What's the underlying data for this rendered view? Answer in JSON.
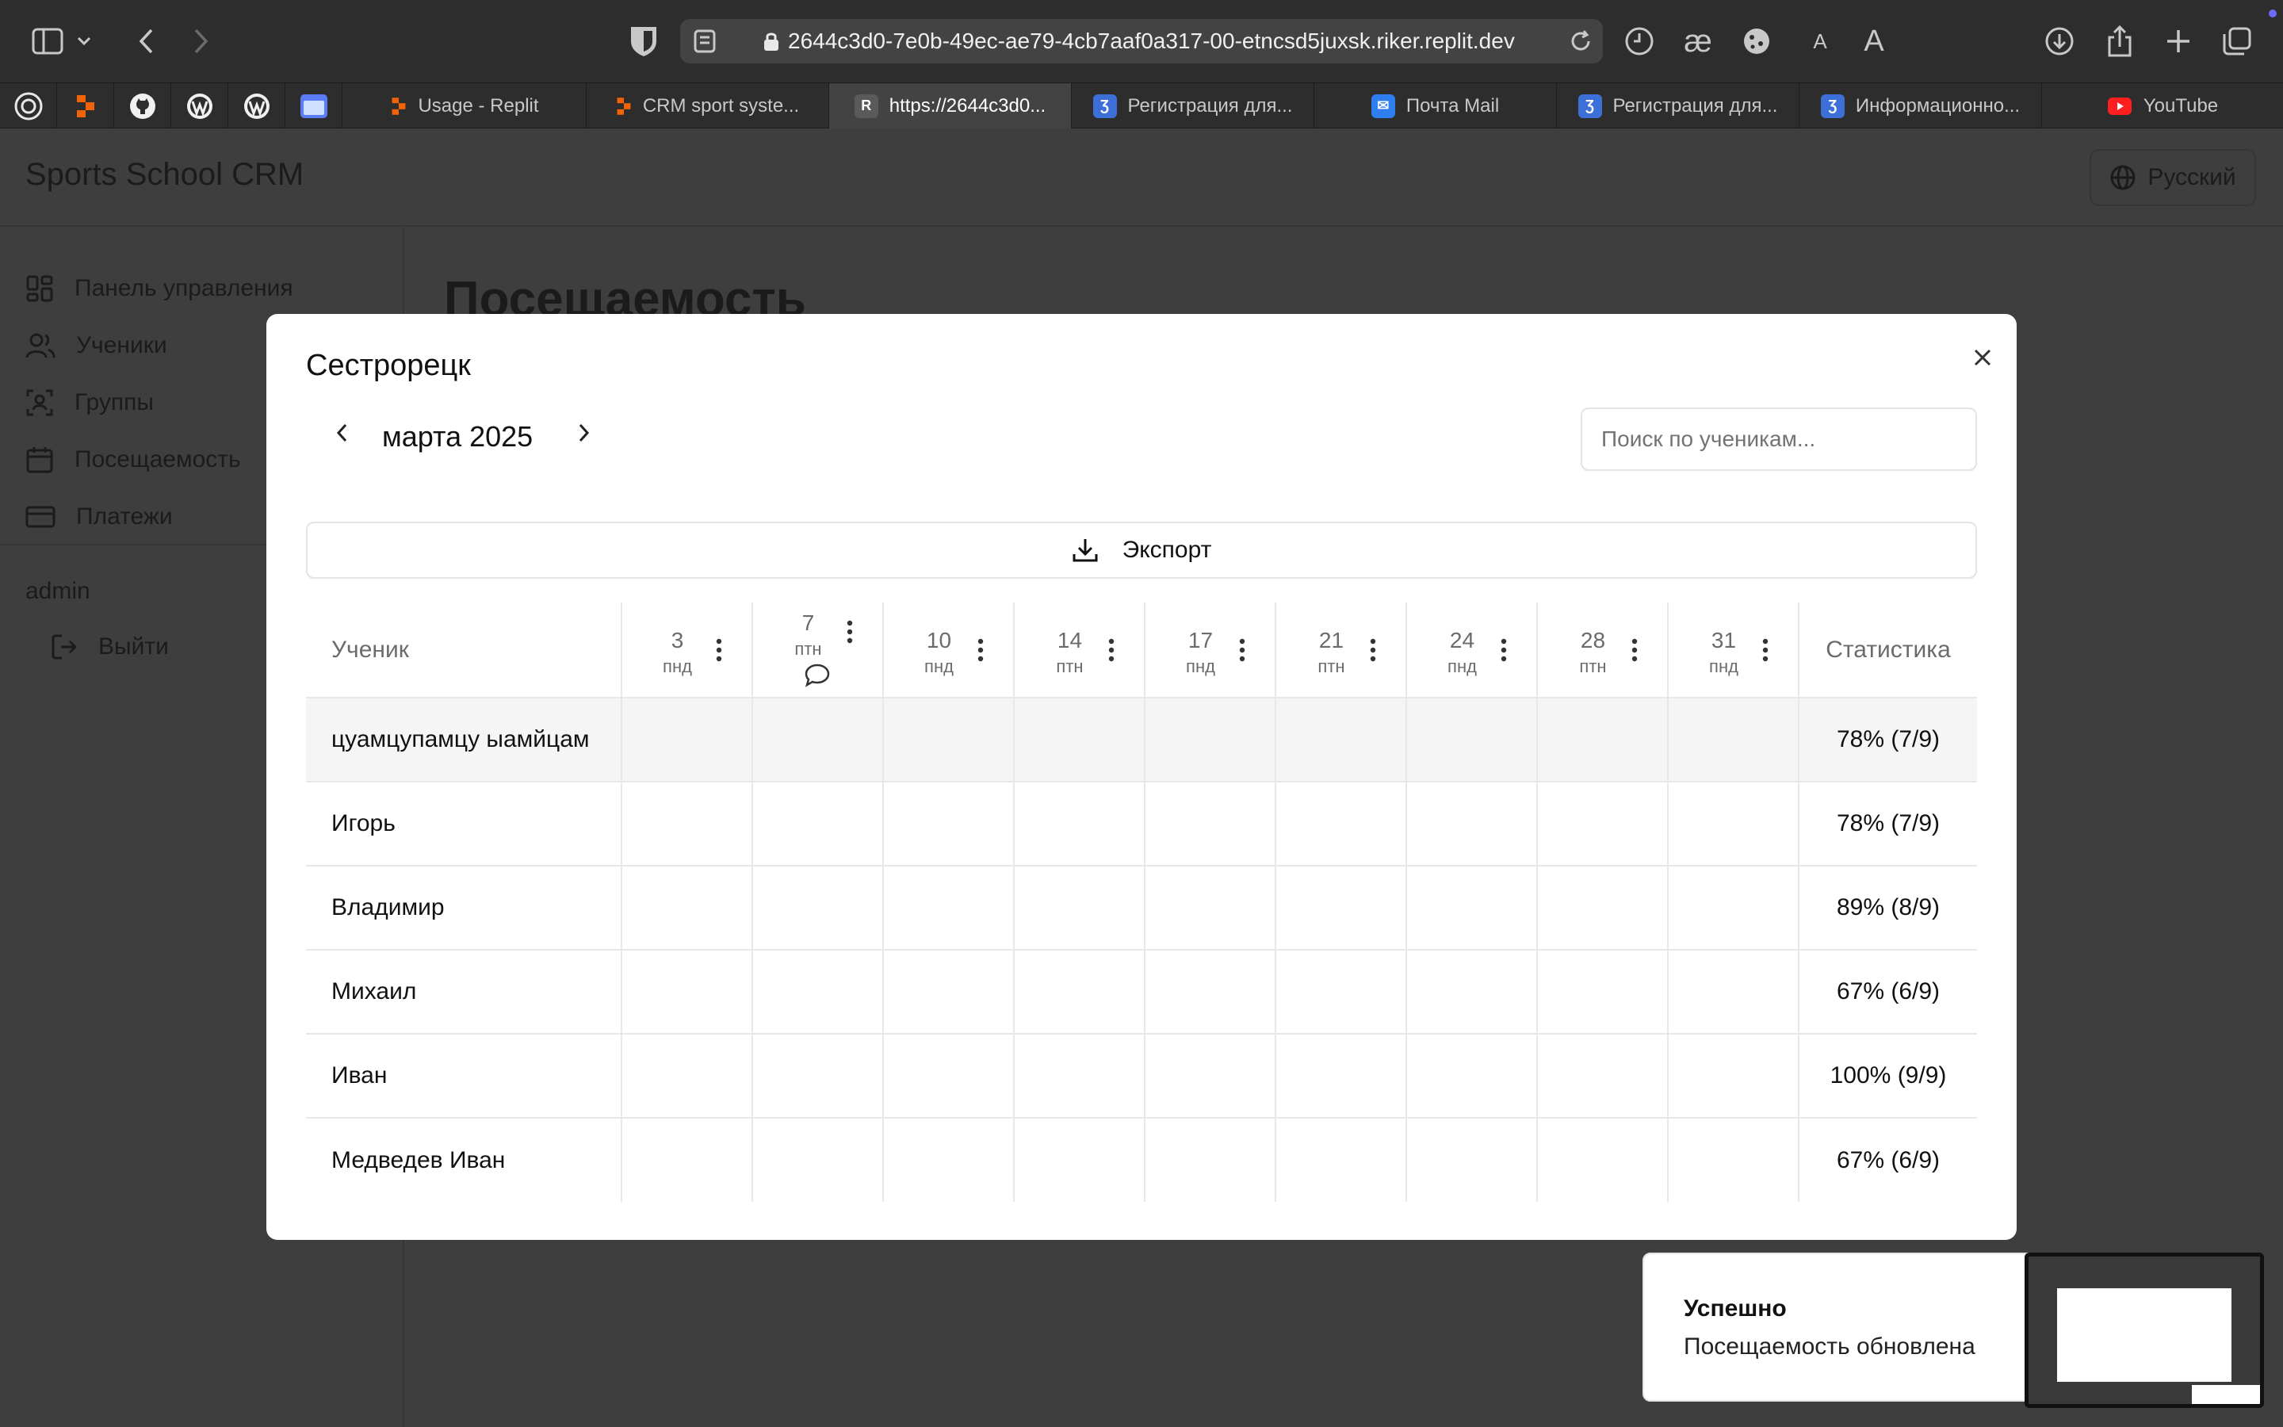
{
  "browser": {
    "url": "2644c3d0-7e0b-49ec-ae79-4cb7aaf0a317-00-etncsd5juxsk.riker.replit.dev",
    "tabs": [
      {
        "label": "Usage - Replit",
        "favicon": "replit-icon",
        "active": false
      },
      {
        "label": "CRM sport syste...",
        "favicon": "replit-icon",
        "active": false
      },
      {
        "label": "https://2644c3d0...",
        "favicon": "r-icon",
        "active": true
      },
      {
        "label": "Регистрация для...",
        "favicon": "gosuslugi-icon",
        "active": false
      },
      {
        "label": "Почта Mail",
        "favicon": "mail-icon",
        "active": false
      },
      {
        "label": "Регистрация для...",
        "favicon": "gosuslugi-icon",
        "active": false
      },
      {
        "label": "Информационно...",
        "favicon": "gosuslugi-icon",
        "active": false
      },
      {
        "label": "YouTube",
        "favicon": "youtube-icon",
        "active": false
      }
    ],
    "pinned": [
      "chatgpt-icon",
      "replit-icon",
      "github-icon",
      "wordpress-icon",
      "wordpress-icon",
      "files-icon"
    ]
  },
  "app": {
    "title": "Sports School CRM",
    "language": "Русский",
    "nav": [
      "Панель управления",
      "Ученики",
      "Группы",
      "Посещаемость",
      "Платежи"
    ],
    "user": "admin",
    "logout": "Выйти",
    "page_heading": "Посещаемость"
  },
  "modal": {
    "title": "Сестрорецк",
    "month": "марта 2025",
    "search_placeholder": "Поиск по ученикам...",
    "export_label": "Экспорт",
    "table": {
      "student_header": "Ученик",
      "stats_header": "Статистика",
      "dates": [
        {
          "num": "3",
          "day": "пнд",
          "note": false
        },
        {
          "num": "7",
          "day": "птн",
          "note": true
        },
        {
          "num": "10",
          "day": "пнд",
          "note": false
        },
        {
          "num": "14",
          "day": "птн",
          "note": false
        },
        {
          "num": "17",
          "day": "пнд",
          "note": false
        },
        {
          "num": "21",
          "day": "птн",
          "note": false
        },
        {
          "num": "24",
          "day": "пнд",
          "note": false
        },
        {
          "num": "28",
          "day": "птн",
          "note": false
        },
        {
          "num": "31",
          "day": "пнд",
          "note": false
        }
      ],
      "rows": [
        {
          "name": "цуамцупамцу ыамйцам",
          "stat": "78% (7/9)"
        },
        {
          "name": "Игорь",
          "stat": "78% (7/9)"
        },
        {
          "name": "Владимир",
          "stat": "89% (8/9)"
        },
        {
          "name": "Михаил",
          "stat": "67% (6/9)"
        },
        {
          "name": "Иван",
          "stat": "100% (9/9)"
        },
        {
          "name": "Медведев Иван",
          "stat": "67% (6/9)"
        }
      ]
    }
  },
  "toast": {
    "title": "Успешно",
    "description": "Посещаемость обновлена"
  },
  "colors": {
    "overlay_background": "#3e3e3e",
    "modal_background": "#ffffff",
    "browser_chrome": "#2d2d2d",
    "active_tab": "#434343"
  }
}
